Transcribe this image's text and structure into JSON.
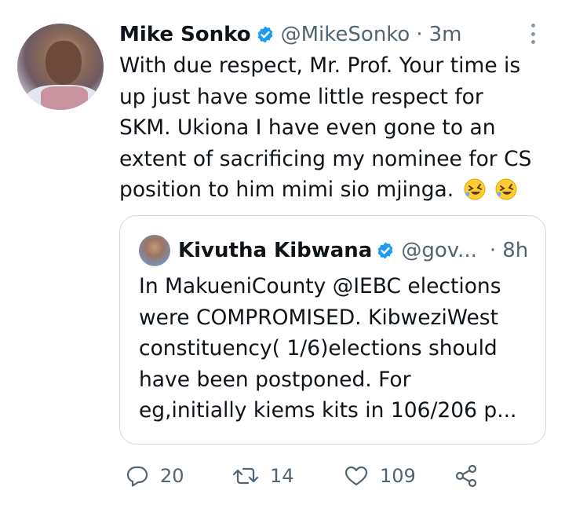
{
  "tweet": {
    "author_name": "Mike Sonko",
    "handle": "@MikeSonko",
    "separator": "·",
    "time": "3m",
    "text_lines": [
      "With due respect, Mr. Prof. Your time is",
      "up just have some little respect for",
      "SKM. Ukiona I have even gone to an",
      "extent of sacrificing my nominee for CS",
      "position to him mimi sio mjinga."
    ],
    "emojis": [
      "rolling-on-floor-laughing-emoji",
      "rolling-on-floor-laughing-emoji"
    ]
  },
  "quote": {
    "author_name": "Kivutha Kibwana",
    "handle": "@gov...",
    "separator": "·",
    "time": "8h",
    "text_lines": [
      "In MakueniCounty @IEBC elections",
      "were COMPROMISED.  KibweziWest",
      "constituency( 1/6)elections should",
      "have been postponed. For",
      "eg,initially kiems kits in 106/206 p..."
    ]
  },
  "actions": {
    "reply_count": "20",
    "retweet_count": "14",
    "like_count": "109"
  },
  "icons": {
    "verified": "verified-badge-icon",
    "more": "more-vertical-icon",
    "reply": "reply-icon",
    "retweet": "retweet-icon",
    "like": "heart-icon",
    "share": "share-icon"
  },
  "colors": {
    "verified_blue": "#1d9bf0",
    "secondary_text": "#536471",
    "border": "#cfd9de",
    "text": "#0f1419"
  }
}
